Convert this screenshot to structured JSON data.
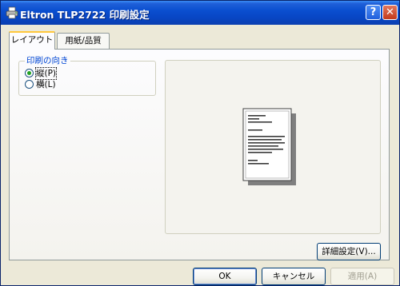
{
  "window": {
    "title": "Eltron TLP2722 印刷設定"
  },
  "titlebar": {
    "help_label": "?",
    "close_label": "✕"
  },
  "tabs": [
    {
      "label": "レイアウト",
      "active": true
    },
    {
      "label": "用紙/品質",
      "active": false
    }
  ],
  "orientation": {
    "label": "印刷の向き",
    "options": [
      {
        "label": "縦(P)",
        "selected": true
      },
      {
        "label": "横(L)",
        "selected": false
      }
    ]
  },
  "buttons": {
    "advanced": "詳細設定(V)...",
    "ok": "OK",
    "cancel": "キャンセル",
    "apply": "適用(A)"
  },
  "colors": {
    "titlebar": "#0a4fd0",
    "dialog_bg": "#ece9d8",
    "group_label": "#0046d5",
    "radio_dot": "#21a121"
  },
  "icons": {
    "title": "printer-icon",
    "preview": "portrait-page-icon"
  }
}
